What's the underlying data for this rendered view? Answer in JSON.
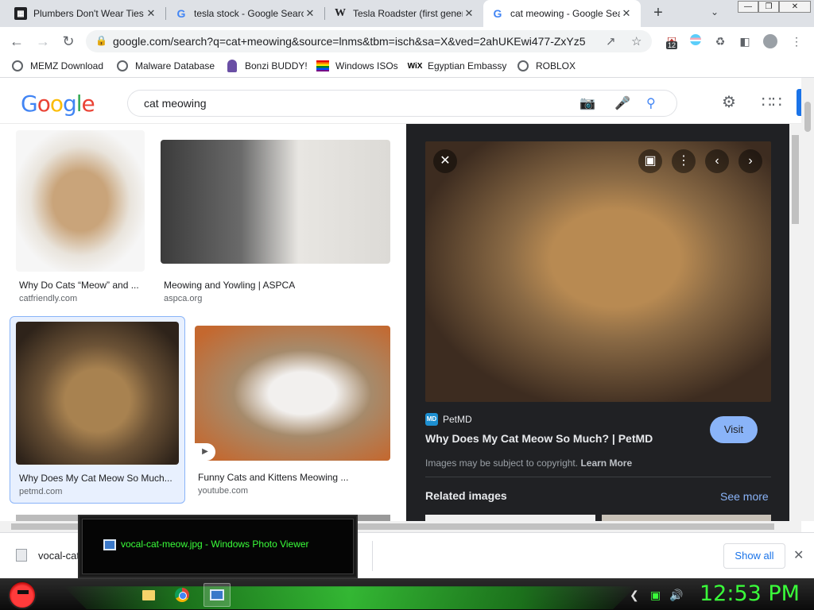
{
  "tabs": [
    {
      "title": "Plumbers Don't Wear Ties",
      "favicon": "building-icon"
    },
    {
      "title": "tesla stock - Google Search",
      "favicon": "google-icon"
    },
    {
      "title": "Tesla Roadster (first generation)",
      "favicon": "wikipedia-icon"
    },
    {
      "title": "cat meowing - Google Search",
      "favicon": "google-icon",
      "active": true
    }
  ],
  "address": {
    "url": "google.com/search?q=cat+meowing&source=lnms&tbm=isch&sa=X&ved=2ahUKEwi477-ZxYz5"
  },
  "extensions": {
    "badge": "12"
  },
  "bookmarks": [
    {
      "label": "MEMZ Download",
      "icon": "globe-icon"
    },
    {
      "label": "Malware Database",
      "icon": "globe-icon"
    },
    {
      "label": "Bonzi BUDDY!",
      "icon": "bonzi-icon"
    },
    {
      "label": "Windows ISOs",
      "icon": "rainbow-flag-icon"
    },
    {
      "label": "Egyptian Embassy",
      "icon": "wix-icon"
    },
    {
      "label": "ROBLOX",
      "icon": "globe-icon"
    }
  ],
  "google": {
    "logo_letters": [
      {
        "ch": "G",
        "color": "#4285f4"
      },
      {
        "ch": "o",
        "color": "#ea4335"
      },
      {
        "ch": "o",
        "color": "#fbbc05"
      },
      {
        "ch": "g",
        "color": "#4285f4"
      },
      {
        "ch": "l",
        "color": "#34a853"
      },
      {
        "ch": "e",
        "color": "#ea4335"
      }
    ],
    "query": "cat meowing"
  },
  "results": [
    {
      "caption": "Why Do Cats “Meow” and ...",
      "source": "catfriendly.com"
    },
    {
      "caption": "Meowing and Yowling | ASPCA",
      "source": "aspca.org"
    },
    {
      "caption": "Why Does My Cat Meow So Much...",
      "source": "petmd.com",
      "selected": true
    },
    {
      "caption": "Funny Cats and Kittens Meowing ...",
      "source": "youtube.com",
      "video": true
    }
  ],
  "panel": {
    "source_name": "PetMD",
    "source_icon_text": "MD",
    "title": "Why Does My Cat Meow So Much? | PetMD",
    "visit_label": "Visit",
    "copyright_text": "Images may be subject to copyright.",
    "learn_more": "Learn More",
    "related_label": "Related images",
    "see_more": "See more"
  },
  "download": {
    "filename": "vocal-cat",
    "show_all": "Show all"
  },
  "preview": {
    "title": "vocal-cat-meow.jpg - Windows Photo Viewer"
  },
  "taskbar": {
    "clock": "12:53 PM"
  },
  "colors": {
    "accent": "#1a73e8",
    "panel_bg": "#202124",
    "clock": "#3aff3a",
    "visit": "#8ab4f8"
  }
}
